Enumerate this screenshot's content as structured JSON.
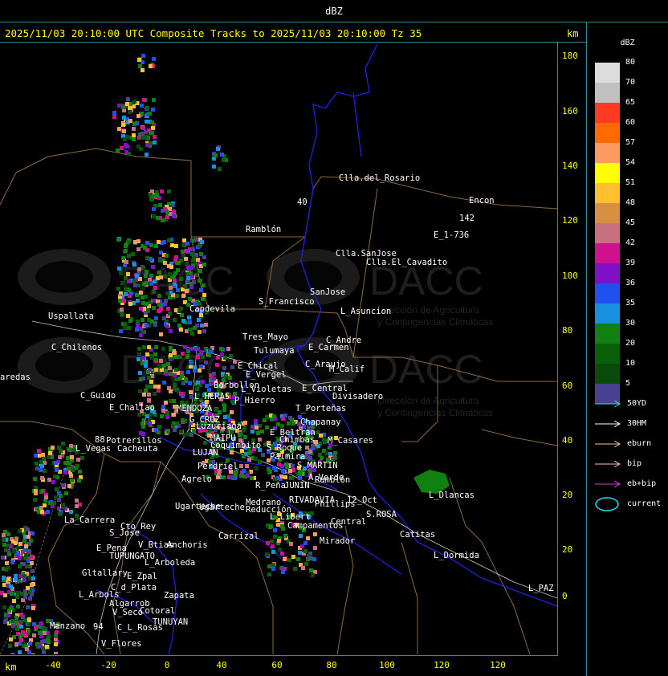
{
  "title": "dBZ",
  "header": "2025/11/03 20:10:00 UTC Composite Tracks to 2025/11/03 20:10:00 Tz 35",
  "axis_unit": "km",
  "y_ticks": [
    "180",
    "160",
    "140",
    "120",
    "100",
    "80",
    "60",
    "40",
    "20",
    "0"
  ],
  "x_ticks": [
    "-40",
    "-20",
    "0",
    "20",
    "40",
    "60",
    "80",
    "100",
    "120"
  ],
  "legend": {
    "title": "dBZ",
    "levels": [
      {
        "label": "80",
        "color": "#dcdcdc"
      },
      {
        "label": "70",
        "color": "#c0c0c0"
      },
      {
        "label": "65",
        "color": "#ff3a20"
      },
      {
        "label": "60",
        "color": "#ff6a00"
      },
      {
        "label": "57",
        "color": "#ff9a60"
      },
      {
        "label": "54",
        "color": "#ffff00"
      },
      {
        "label": "51",
        "color": "#ffc030"
      },
      {
        "label": "48",
        "color": "#d89040"
      },
      {
        "label": "45",
        "color": "#c87080"
      },
      {
        "label": "42",
        "color": "#d0108c"
      },
      {
        "label": "39",
        "color": "#8010c8"
      },
      {
        "label": "36",
        "color": "#2050f0"
      },
      {
        "label": "35",
        "color": "#1890e0"
      },
      {
        "label": "30",
        "color": "#108010"
      },
      {
        "label": "20",
        "color": "#086008"
      },
      {
        "label": "10",
        "color": "#0a4a0a"
      },
      {
        "label": "5",
        "color": "#484090"
      }
    ],
    "tracks": [
      {
        "label": "50YD",
        "color": "#40e0e0"
      },
      {
        "label": "30HM",
        "color": "#ffffff"
      },
      {
        "label": "eburn",
        "color": "#ffc080"
      },
      {
        "label": "bip",
        "color": "#ffc0c0"
      },
      {
        "label": "eb+bip",
        "color": "#e040e0"
      }
    ],
    "current_label": "current",
    "current_color": "#20e0ff"
  },
  "places": [
    "Clla.del_Rosario",
    "Encon",
    "Ramblón",
    "E_1-736",
    "Clla.SanJose",
    "Clla.El_Cavadito",
    "Uspallata",
    "Ugarteche",
    "Capdevila",
    "S_Francisco",
    "SanJose",
    "L_Asuncion",
    "C_Chilenos",
    "Tres_Mayo",
    "C_Andre",
    "Tulumaya",
    "E_Carmen",
    "E_Chical",
    "C_Araujo",
    "M_Calif",
    "E_Vergel",
    "Borbollon",
    "L_Violetas",
    "E_Central",
    "Divisadero",
    "C_Guido",
    "L_HERAS",
    "P_Hierro",
    "T_Porteñas",
    "E_Challao",
    "MENDOZA",
    "Chapanay",
    "G_CRUZ",
    "Luzuriaga",
    "E_Beltran",
    "Chimbas",
    "M_Casares",
    "Potrerillos",
    "L_Vegas",
    "Cacheuta",
    "MAIPU",
    "Coquimbito",
    "S_Roque",
    "Palmira",
    "S_MARTIN",
    "Perdriel",
    "LUJAN",
    "A_Verde",
    "Ramblón",
    "Agrelo",
    "R_Peña",
    "JUNIN",
    "L_Dlancas",
    "RIVADAVIA",
    "Phillips",
    "12_Oct",
    "Medrano",
    "Reducción",
    "La_Carrera",
    "Cto_Rey",
    "S_Jose",
    "S.ROSA",
    "Ugarteche",
    "L_Libert",
    "Campamentos",
    "Central",
    "Catitas",
    "Carrizal",
    "V_Btias",
    "Anchoris",
    "E_Pena",
    "TUPUNGATO",
    "Mirador",
    "L_Arboleda",
    "L_Dormida",
    "E_Zpal",
    "Gltallary",
    "C_d_Plata",
    "L_PAZ",
    "L_Arbols",
    "Zapata",
    "Algarrob",
    "V_Seco",
    "Cotoral",
    "TUNUYAN",
    "Manzano",
    "C_L_Rosas",
    "V_Flores",
    "aredas",
    "40",
    "142",
    "88",
    "94"
  ],
  "watermark": {
    "brand": "DACC",
    "tagline_1": "Dirección de Agricultura",
    "tagline_2": "y Contingencias Climáticas"
  }
}
